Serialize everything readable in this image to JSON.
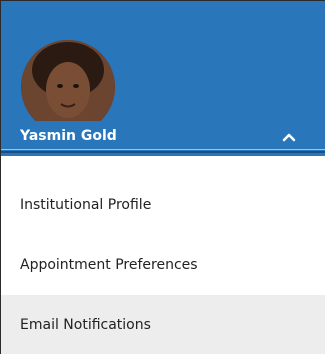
{
  "profile": {
    "name": "Yasmin Gold",
    "header_color": "#2a76ba",
    "toggle_icon": "chevron-up-icon"
  },
  "menu": {
    "items": [
      {
        "label": "Institutional Profile",
        "active": false
      },
      {
        "label": "Appointment Preferences",
        "active": false
      },
      {
        "label": "Email Notifications",
        "active": true
      }
    ]
  }
}
